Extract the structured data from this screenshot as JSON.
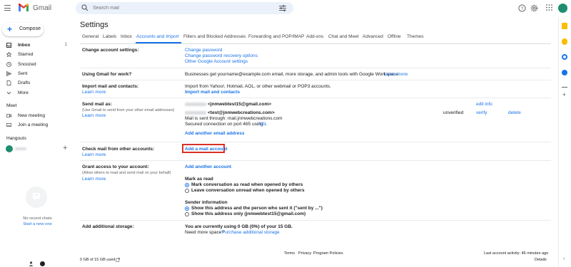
{
  "app": {
    "brand": "Gmail"
  },
  "search": {
    "placeholder": "Search mail"
  },
  "compose": {
    "label": "Compose"
  },
  "sidebar": {
    "items": [
      {
        "label": "Inbox",
        "count": "1",
        "icon": "inbox-icon"
      },
      {
        "label": "Starred",
        "icon": "star-icon"
      },
      {
        "label": "Snoozed",
        "icon": "clock-icon"
      },
      {
        "label": "Sent",
        "icon": "send-icon"
      },
      {
        "label": "Drafts",
        "icon": "draft-icon"
      },
      {
        "label": "More",
        "icon": "chevron-down-icon"
      }
    ],
    "meet": {
      "title": "Meet",
      "items": [
        {
          "label": "New meeting",
          "icon": "video-icon"
        },
        {
          "label": "Join a meeting",
          "icon": "keyboard-icon"
        }
      ]
    },
    "hangouts": {
      "title": "Hangouts",
      "no_chats": "No recent chats",
      "start_link": "Start a new one"
    }
  },
  "settings": {
    "title": "Settings",
    "tabs": [
      "General",
      "Labels",
      "Inbox",
      "Accounts and Import",
      "Filters and Blocked Addresses",
      "Forwarding and POP/IMAP",
      "Add-ons",
      "Chat and Meet",
      "Advanced",
      "Offline",
      "Themes"
    ],
    "active_tab": "Accounts and Import",
    "change_account": {
      "label": "Change account settings:",
      "links": [
        "Change password",
        "Change password recovery options",
        "Other Google Account settings"
      ]
    },
    "gmail_for_work": {
      "label": "Using Gmail for work?",
      "text": "Businesses get yourname@example.com email, more storage, and admin tools with Google Workspace.",
      "link": "Learn more"
    },
    "import": {
      "label": "Import mail and contacts:",
      "learn_more": "Learn more",
      "text": "Import from Yahoo!, Hotmail, AOL, or other webmail or POP3 accounts.",
      "link": "Import mail and contacts"
    },
    "send_as": {
      "label": "Send mail as:",
      "sub": "(Use Gmail to send from your other email addresses)",
      "learn_more": "Learn more",
      "addr1": "<jnmwebtest15@gmail.com>",
      "edit_info": "edit info",
      "addr2": "<test@jnmwebcreations.com>",
      "sent_through": "Mail is sent through: mail.jnmwebcreations.com",
      "secured": "Secured connection on port 465 using",
      "ssl": "SSL",
      "unverified": "unverified",
      "verify": "verify",
      "delete": "delete",
      "add_another": "Add another email address"
    },
    "check_mail": {
      "label": "Check mail from other accounts:",
      "learn_more": "Learn more",
      "add_account": "Add a mail account"
    },
    "grant_access": {
      "label": "Grant access to your account:",
      "sub": "(Allow others to read and send mail on your behalf)",
      "learn_more": "Learn more",
      "add_another": "Add another account",
      "mark_as_read_title": "Mark as read",
      "opt1": "Mark conversation as read when opened by others",
      "opt2": "Leave conversation unread when opened by others",
      "sender_info_title": "Sender information",
      "opt3": "Show this address and the person who sent it (\"sent by ...\")",
      "opt4": "Show this address only (jnmwebtest15@gmail.com)"
    },
    "storage": {
      "label": "Add additional storage:",
      "text": "You are currently using 0 GB (0%) of your 15 GB.",
      "need_more": "Need more space?",
      "purchase": "Purchase additional storage"
    }
  },
  "footer": {
    "usage": "0 GB of 15 GB used",
    "terms": "Terms",
    "sep": "·",
    "privacy": "Privacy",
    "policies": "Program Policies",
    "last_activity": "Last account activity: 46 minutes ago",
    "details": "Details"
  },
  "colors": {
    "accent": "#1a73e8",
    "highlight": "#d93025"
  }
}
